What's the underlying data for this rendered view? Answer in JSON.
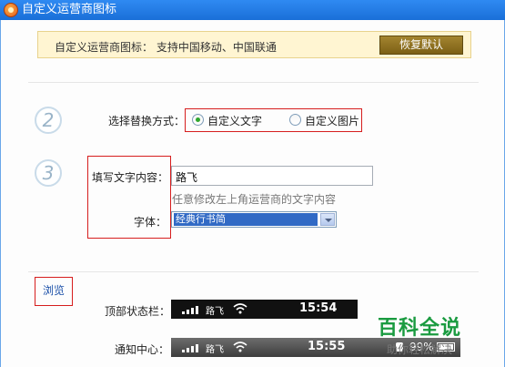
{
  "window": {
    "title": "自定义运营商图标"
  },
  "notice": {
    "text": "自定义运营商图标：  支持中国移动、中国联通",
    "restore_button": "恢复默认"
  },
  "steps": {
    "two": "2",
    "three": "3"
  },
  "replace_mode": {
    "label": "选择替换方式：",
    "options": [
      {
        "label": "自定义文字",
        "checked": true
      },
      {
        "label": "自定义图片",
        "checked": false
      }
    ]
  },
  "text_content": {
    "label": "填写文字内容：",
    "value": "路飞",
    "hint": "任意修改左上角运营商的文字内容"
  },
  "font": {
    "label": "字体：",
    "selected": "经典行书简"
  },
  "browse": {
    "label": "浏览",
    "top_status": {
      "label": "顶部状态栏：",
      "carrier": "路飞",
      "time": "15:54"
    },
    "notify_center": {
      "label": "通知中心：",
      "carrier": "路飞",
      "time": "15:55",
      "battery": "99%"
    }
  },
  "watermark": {
    "title": "百科全说",
    "subtitle": "助你轻松解决"
  },
  "colors": {
    "titlebar": "#1a6fd8",
    "button": "#7c6015",
    "highlight": "#d61e1e",
    "radio_checked": "#2fa72f"
  }
}
